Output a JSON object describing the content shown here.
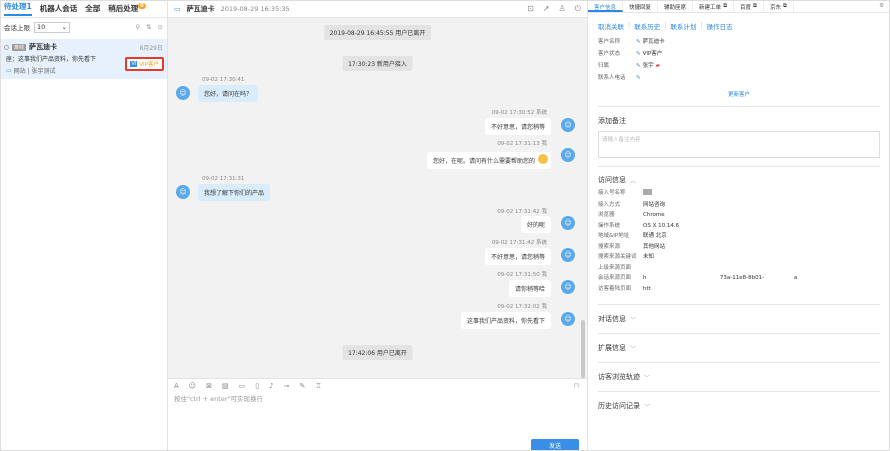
{
  "left": {
    "tabs": [
      {
        "label": "待处理1",
        "active": true
      },
      {
        "label": "机器人会话",
        "active": false
      },
      {
        "label": "全部",
        "active": false
      },
      {
        "label": "稍后处理",
        "active": false
      }
    ],
    "later_badge": "0",
    "limit_label": "会话上限",
    "limit_value": "10",
    "conversation": {
      "tag": "离线",
      "name": "萨瓦迪卡",
      "date": "8月29日",
      "message": "座：这事我们产品资料，你先看下",
      "source": "网站 | 张宇测试",
      "vip_icon": "VI",
      "vip_label": "VIP客户"
    }
  },
  "mid": {
    "header": {
      "name": "萨瓦迪卡",
      "time": "2019-08-29 16:35:35"
    },
    "messages": {
      "sys1": "2019-08-29 16:45:55 用户已离开",
      "sys2": "17:30:23 新用户接入",
      "m1_meta": "09-02 17:30:41",
      "m1": "您好，请问在吗？",
      "m2_meta": "09-02 17:30:52 系统",
      "m2": "不好意思，请您稍等",
      "m3_meta": "09-02 17:31:13 我",
      "m3": "您好，在呢。请问有什么需要帮助您的",
      "m4_meta": "09-02 17:31:31",
      "m4": "我想了解下你们的产品",
      "m5_meta": "09-02 17:31:42 我",
      "m5": "好的呢",
      "m6_meta": "09-02 17:31:42 系统",
      "m6": "不好意思，请您稍等",
      "m7_meta": "09-02 17:31:50 我",
      "m7": "请你稍等哈",
      "m8_meta": "09-02 17:32:02 我",
      "m8": "这事我们产品资料，你先看下",
      "sys3": "17:42:06 用户已离开"
    },
    "composer": {
      "hint": "按住\"ctrl + enter\"可实现换行",
      "send": "发送"
    }
  },
  "right": {
    "tabs": [
      {
        "label": "客户信息",
        "active": true
      },
      {
        "label": "快捷回复",
        "active": false
      },
      {
        "label": "辅助座席",
        "active": false
      },
      {
        "label": "新建工单",
        "active": false
      },
      {
        "label": "百度",
        "active": false
      },
      {
        "label": "京东",
        "active": false
      }
    ],
    "actions": [
      "取消关联",
      "联系历史",
      "联系计划",
      "操作日志"
    ],
    "customer": [
      {
        "k": "客户名称",
        "v": "萨瓦迪卡"
      },
      {
        "k": "客户状态",
        "v": "VIP客户"
      },
      {
        "k": "归属",
        "v": "张宇"
      },
      {
        "k": "联系人电话",
        "v": ""
      }
    ],
    "update_link": "更新客户",
    "note_title": "添加备注",
    "note_placeholder": "请输入备注内容",
    "visit_title": "访问信息",
    "visit": [
      {
        "k": "接入号名称",
        "v": ""
      },
      {
        "k": "接入方式",
        "v": "网站咨询"
      },
      {
        "k": "浏览器",
        "v": "Chrome"
      },
      {
        "k": "操作系统",
        "v": "OS X 10.14.6"
      },
      {
        "k": "地域&IP地址",
        "v": "联通 北京"
      },
      {
        "k": "搜索来源",
        "v": "其他网站"
      },
      {
        "k": "搜索来源关键词",
        "v": "未知"
      },
      {
        "k": "上级来源页面",
        "v": ""
      },
      {
        "k": "会话来源页面",
        "v": "h                                          73a-11e8-8b01-                 a"
      },
      {
        "k": "访客着陆页面",
        "v": "htt"
      }
    ],
    "sections": [
      "对话信息",
      "扩展信息",
      "访客浏览轨迹",
      "历史访问记录"
    ]
  }
}
